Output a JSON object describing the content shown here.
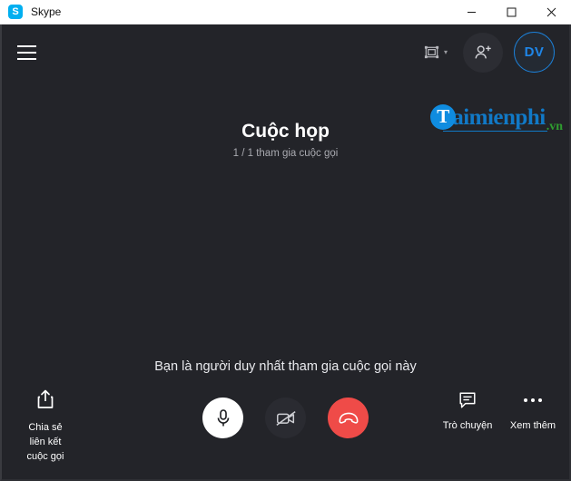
{
  "titlebar": {
    "app_name": "Skype",
    "logo_letter": "S",
    "minimize_label": "–",
    "maximize_label": "□",
    "close_label": "✕"
  },
  "topbar": {
    "menu_icon": "hamburger-menu-icon",
    "layout_icon": "layout-grid-icon",
    "layout_chevron": "▾",
    "add_person_icon": "add-person-icon",
    "avatar_initials": "DV"
  },
  "watermark": {
    "logo_letter": "T",
    "name": "aimienphi",
    "tld": ".vn",
    "brand_blue": "#1179c6",
    "tld_green": "#2f9e2f",
    "circle_blue": "#0f8ce0"
  },
  "meeting": {
    "title": "Cuộc họp",
    "participants": "1 / 1 tham gia cuộc gọi",
    "alone_message": "Bạn là người duy nhất tham gia cuộc gọi này"
  },
  "controls": {
    "share": {
      "icon": "share-upload-icon",
      "label": "Chia sẻ\nliên kết\ncuộc gọi"
    },
    "mic": {
      "icon": "microphone-icon",
      "state": "on",
      "color": "#ffffff"
    },
    "camera": {
      "icon": "camera-off-icon",
      "state": "off",
      "color": "#2a2b31"
    },
    "hangup": {
      "icon": "hangup-phone-icon",
      "color": "#ef4b48"
    },
    "chat": {
      "icon": "chat-bubble-icon",
      "label": "Trò chuyện"
    },
    "more": {
      "icon": "more-dots-icon",
      "label": "Xem thêm"
    }
  },
  "colors": {
    "app_bg": "#232429",
    "titlebar_bg": "#ffffff",
    "accent_blue": "#1f86e8",
    "hangup_red": "#ef4b48"
  }
}
